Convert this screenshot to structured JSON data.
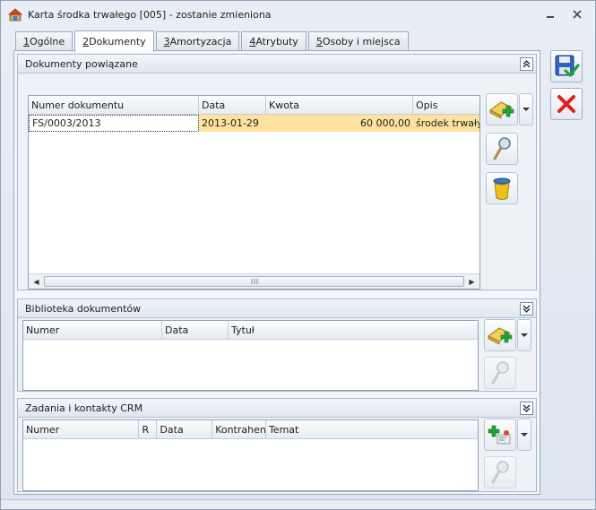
{
  "window": {
    "title": "Karta środka trwałego [005] - zostanie zmieniona"
  },
  "tabs": [
    {
      "key": "1",
      "label": " Ogólne",
      "active": false
    },
    {
      "key": "2",
      "label": " Dokumenty",
      "active": true
    },
    {
      "key": "3",
      "label": " Amortyzacja",
      "active": false
    },
    {
      "key": "4",
      "label": " Atrybuty",
      "active": false
    },
    {
      "key": "5",
      "label": " Osoby i miejsca",
      "active": false
    }
  ],
  "dokumenty_powiazane": {
    "title": "Dokumenty powiązane",
    "columns": [
      "Numer dokumentu",
      "Data",
      "Kwota",
      "Opis"
    ],
    "rows": [
      {
        "numer": "FS/0003/2013",
        "data": "2013-01-29",
        "kwota": "60 000,00",
        "opis": "środek trwały"
      }
    ]
  },
  "biblioteka_dokumentow": {
    "title": "Biblioteka dokumentów",
    "columns": [
      "Numer",
      "Data",
      "Tytuł"
    ]
  },
  "zadania_crm": {
    "title": "Zadania i kontakty CRM",
    "columns": [
      "Numer",
      "R",
      "Data",
      "Kontrahent",
      "Temat"
    ]
  },
  "colors": {
    "selected_row": "#ffe2a0",
    "cancel_red": "#e0201b",
    "save_blue": "#2d64c4",
    "add_green": "#22a83a"
  },
  "icons": {
    "app": "app-icon",
    "save": "save-floppy-icon",
    "cancel": "cancel-x-icon",
    "add_document": "add-document-icon",
    "preview": "magnifier-icon",
    "delete": "trash-bin-icon",
    "add_task": "add-task-icon"
  }
}
